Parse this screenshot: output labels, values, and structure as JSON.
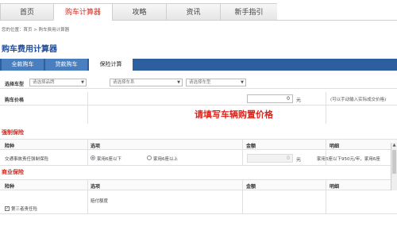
{
  "nav": {
    "items": [
      "首页",
      "购车计算器",
      "攻略",
      "资讯",
      "新手指引"
    ],
    "active_index": 1
  },
  "breadcrumb": {
    "prefix": "您的位置：",
    "home": "首页",
    "sep": " > ",
    "current": "购车费用计算器"
  },
  "page_title": "购车费用计算器",
  "tabs": [
    "全款购车",
    "贷款购车",
    "保险计算"
  ],
  "active_tab": 2,
  "model_row": {
    "label": "选择车型",
    "brand_placeholder": "请选择品牌",
    "series_placeholder": "请选择车系",
    "model_placeholder": "请选择车型"
  },
  "price_row": {
    "label": "购车价格",
    "value": "0",
    "unit": "元",
    "hint": "(可以手动输入实际成交价格)"
  },
  "prompt": "请填写车辆购置价格",
  "compulsory": {
    "title": "强制保险",
    "headers": [
      "险种",
      "选项",
      "金额",
      "明细"
    ],
    "row_label": "交通事故责任强制保险",
    "option_a": "家用6座以下",
    "option_b": "家用6座以上",
    "amount": "0",
    "unit": "元",
    "detail": "家用6座以下950元/年，家用6座"
  },
  "commercial": {
    "title": "商业保险",
    "headers": [
      "险种",
      "选项",
      "金额",
      "明细"
    ],
    "row_label": "第三者责任险",
    "option_text": "赔付额度"
  },
  "colors": {
    "accent": "#d9261c",
    "tab_bar": "#2d5f9e",
    "title": "#1f4e9a"
  }
}
